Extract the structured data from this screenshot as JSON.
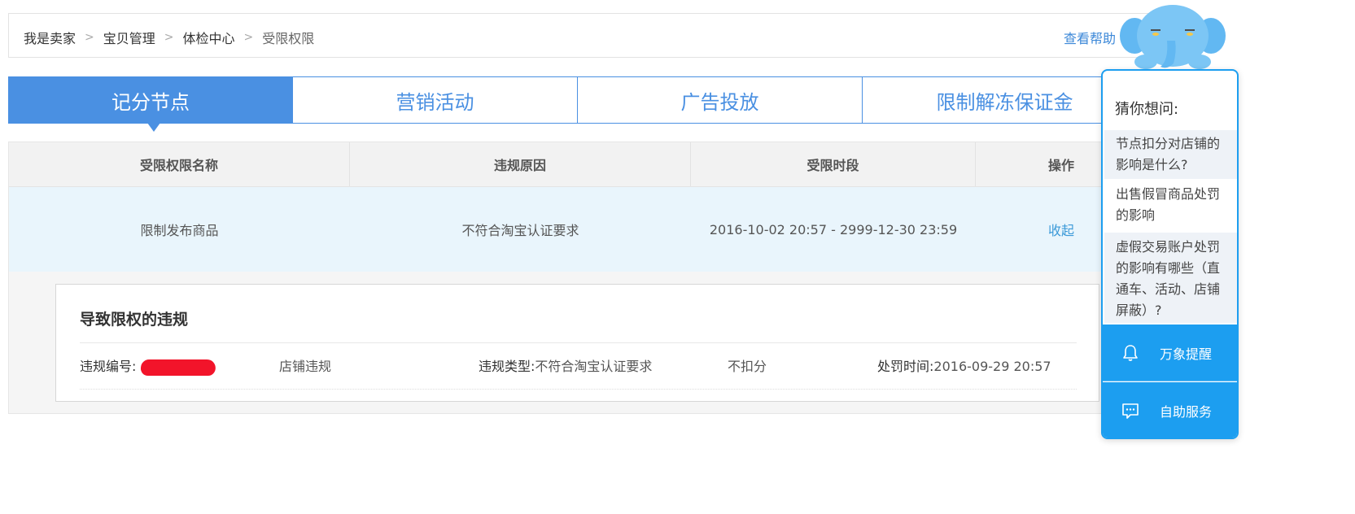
{
  "breadcrumb": {
    "items": [
      "我是卖家",
      "宝贝管理",
      "体检中心",
      "受限权限"
    ],
    "separator": ">",
    "help_link": "查看帮助"
  },
  "tabs": [
    {
      "label": "记分节点",
      "active": true
    },
    {
      "label": "营销活动",
      "active": false
    },
    {
      "label": "广告投放",
      "active": false
    },
    {
      "label": "限制解冻保证金",
      "active": false
    }
  ],
  "table": {
    "headers": [
      "受限权限名称",
      "违规原因",
      "受限时段",
      "操作"
    ],
    "rows": [
      {
        "name": "限制发布商品",
        "reason": "不符合淘宝认证要求",
        "period": "2016-10-02 20:57 - 2999-12-30 23:59",
        "action": "收起"
      }
    ]
  },
  "detail": {
    "title": "导致限权的违规",
    "id_label": "违规编号:",
    "id_value_redacted": true,
    "category": "店铺违规",
    "type_label": "违规类型:",
    "type_value": "不符合淘宝认证要求",
    "points": "不扣分",
    "time_label": "处罚时间:",
    "time_value": "2016-09-29 20:57"
  },
  "float_panel": {
    "title": "猜你想问:",
    "questions": [
      "节点扣分对店铺的影响是什么?",
      "出售假冒商品处罚的影响",
      "虚假交易账户处罚的影响有哪些（直通车、活动、店铺屏蔽）?"
    ],
    "buttons": [
      {
        "label": "万象提醒",
        "icon": "bell-icon"
      },
      {
        "label": "自助服务",
        "icon": "chat-icon"
      }
    ]
  },
  "colors": {
    "primary_blue": "#4a90e2",
    "panel_blue": "#1c9ef0",
    "link_blue": "#3c88d8",
    "row_highlight": "#e9f5fc",
    "redaction": "#f2142a"
  }
}
